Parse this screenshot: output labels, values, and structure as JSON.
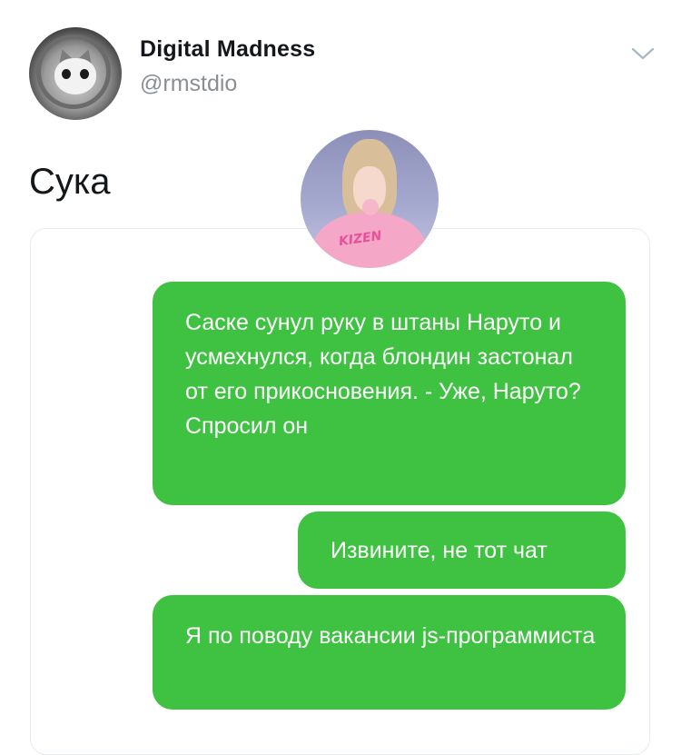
{
  "tweet": {
    "display_name": "Digital Madness",
    "handle": "@rmstdio",
    "text": "Сука",
    "menu_icon": "chevron-down-icon"
  },
  "profile_bubble": {
    "hoodie_text": "KIZEN"
  },
  "messages": [
    {
      "text": "Саске сунул руку в штаны Наруто и усмехнулся, когда блондин застонал от его прикосновения. - Уже, Наруто? Спросил он"
    },
    {
      "text": "Извините, не тот чат"
    },
    {
      "text": "Я по поводу вакансии js-программиста"
    }
  ],
  "colors": {
    "message_bubble": "#3fc141",
    "name": "#14171a",
    "handle": "#8a8f94"
  }
}
